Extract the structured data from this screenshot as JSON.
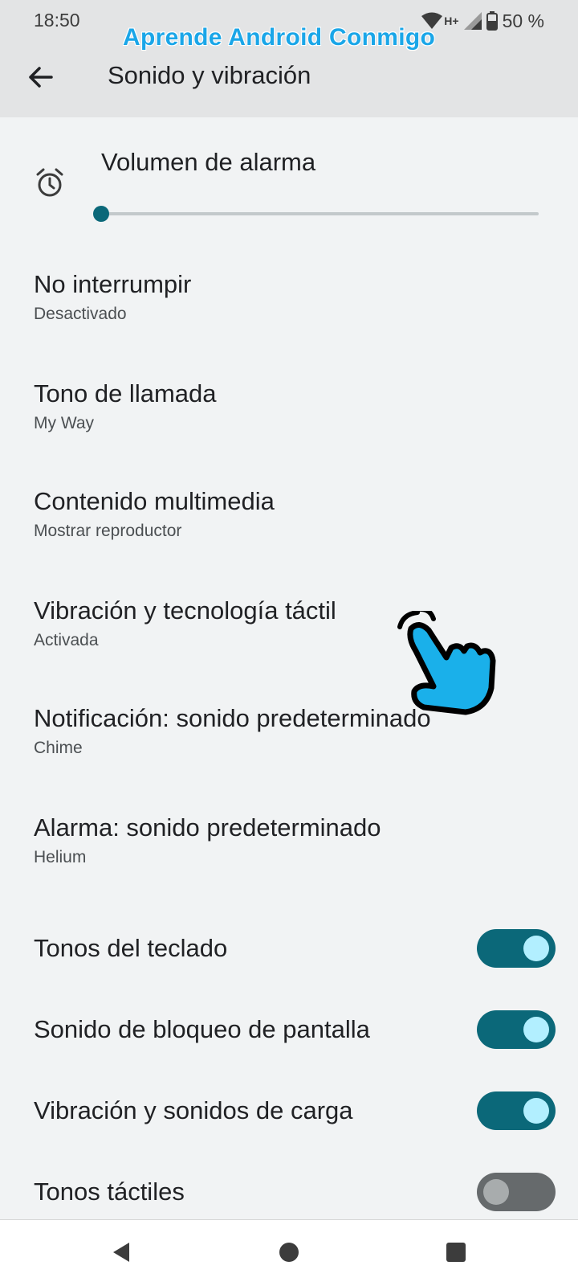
{
  "status_bar": {
    "time": "18:50",
    "network": "H+",
    "battery": "50 %"
  },
  "watermark": "Aprende Android Conmigo",
  "header": {
    "title": "Sonido y vibración"
  },
  "volume": {
    "title": "Volumen de alarma",
    "level": 0
  },
  "settings": [
    {
      "title": "No interrumpir",
      "summary": "Desactivado"
    },
    {
      "title": "Tono de llamada",
      "summary": "My Way"
    },
    {
      "title": "Contenido multimedia",
      "summary": "Mostrar reproductor"
    },
    {
      "title": "Vibración y tecnología táctil",
      "summary": "Activada"
    },
    {
      "title": "Notificación: sonido predeterminado",
      "summary": "Chime"
    },
    {
      "title": "Alarma: sonido predeterminado",
      "summary": "Helium"
    }
  ],
  "toggles": [
    {
      "label": "Tonos del teclado",
      "on": true
    },
    {
      "label": "Sonido de bloqueo de pantalla",
      "on": true
    },
    {
      "label": "Vibración y sonidos de carga",
      "on": true
    },
    {
      "label": "Tonos táctiles",
      "on": false
    }
  ],
  "colors": {
    "accent": "#0b6879",
    "watermark": "#1aa6e8",
    "pointer_hand": "#1ab0ea"
  },
  "icons": {
    "back": "arrow-left-icon",
    "volume": "alarm-clock-icon",
    "wifi": "wifi-icon",
    "signal": "cell-signal-icon",
    "battery": "battery-icon",
    "pointer": "pointing-hand-icon",
    "nav_back": "triangle-back-icon",
    "nav_home": "circle-home-icon",
    "nav_recents": "square-recents-icon"
  }
}
